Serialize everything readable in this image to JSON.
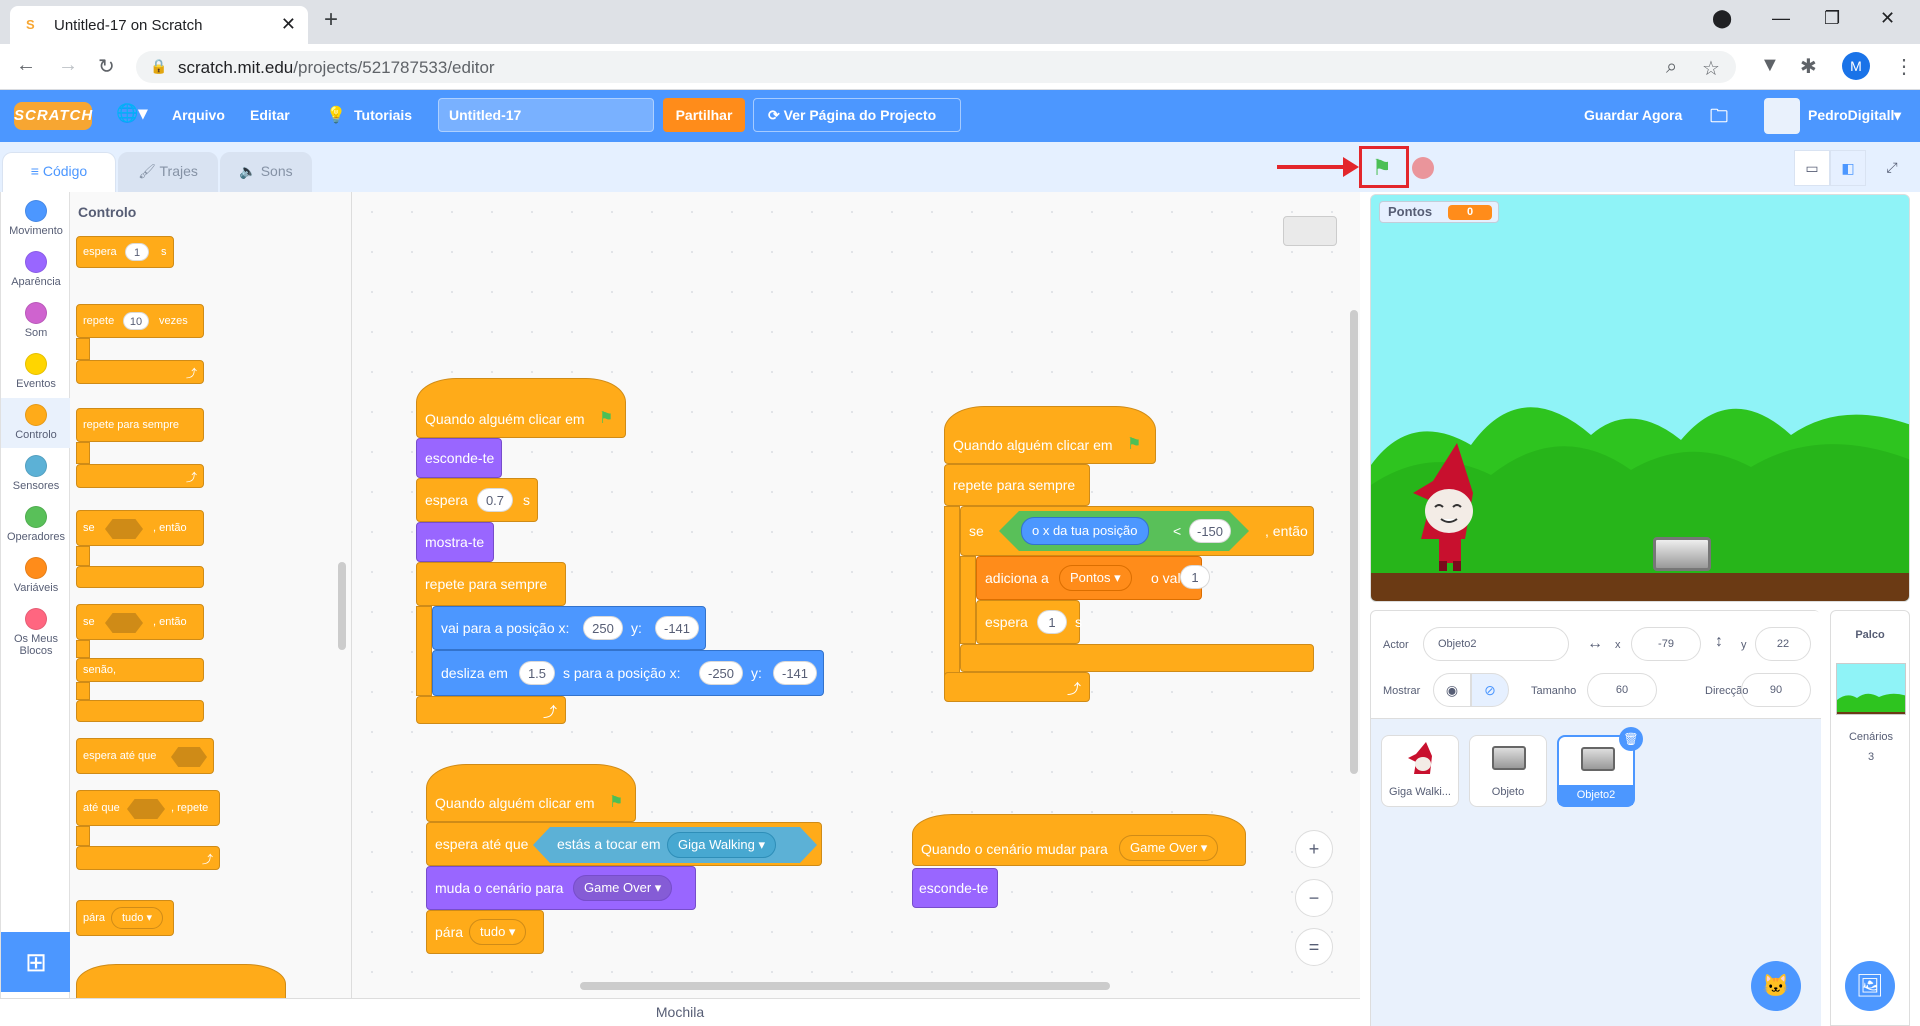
{
  "browser": {
    "tab_title": "Untitled-17 on Scratch",
    "url_host": "scratch.mit.edu",
    "url_path": "/projects/521787533/editor",
    "profile_initial": "M"
  },
  "menu": {
    "logo": "SCRATCH",
    "file": "Arquivo",
    "edit": "Editar",
    "tutorials": "Tutoriais",
    "project_title": "Untitled-17",
    "share": "Partilhar",
    "see_project_page": "Ver Página do Projecto",
    "save_now": "Guardar Agora",
    "username": "PedroDigitall"
  },
  "tabs": {
    "code": "Código",
    "costumes": "Trajes",
    "sounds": "Sons"
  },
  "categories": [
    {
      "label": "Movimento",
      "color": "#4c97ff"
    },
    {
      "label": "Aparência",
      "color": "#9966ff"
    },
    {
      "label": "Som",
      "color": "#cf63cf"
    },
    {
      "label": "Eventos",
      "color": "#ffd500"
    },
    {
      "label": "Controlo",
      "color": "#ffab19"
    },
    {
      "label": "Sensores",
      "color": "#5cb1d6"
    },
    {
      "label": "Operadores",
      "color": "#59c059"
    },
    {
      "label": "Variáveis",
      "color": "#ff8c1a"
    },
    {
      "label": "Os Meus Blocos",
      "color": "#ff6680"
    }
  ],
  "palette": {
    "title": "Controlo",
    "wait": "espera",
    "wait_val": "1",
    "wait_unit": "s",
    "repeat": "repete",
    "repeat_val": "10",
    "repeat_unit": "vezes",
    "forever": "repete para sempre",
    "if": "se",
    "then": ", então",
    "else": "senão,",
    "wait_until": "espera até que",
    "repeat_until": "até que",
    "repeat_until_suffix": ", repete",
    "stop": "pára",
    "stop_opt": "tudo"
  },
  "scripts": {
    "s1": {
      "hat": "Quando alguém clicar em",
      "hide": "esconde-te",
      "wait": "espera",
      "wait_val": "0.7",
      "wait_unit": "s",
      "show": "mostra-te",
      "forever": "repete para sempre",
      "goto": "vai para a posição x:",
      "goto_x": "250",
      "y_lbl": "y:",
      "goto_y": "-141",
      "glide": "desliza em",
      "glide_t": "1.5",
      "glide_mid": "s para a posição x:",
      "glide_x": "-250",
      "glide_y": "-141"
    },
    "s2": {
      "hat": "Quando alguém clicar em",
      "forever": "repete para sempre",
      "if": "se",
      "xpos": "o x da tua posição",
      "lt": "<",
      "lt_val": "-150",
      "then": ", então",
      "change": "adiciona a",
      "var": "Pontos",
      "by": "o valor",
      "by_val": "1",
      "wait": "espera",
      "wait_val": "1",
      "wait_unit": "s"
    },
    "s3": {
      "hat": "Quando alguém clicar em",
      "wait_until": "espera até que",
      "touching": "estás a tocar em",
      "touch_target": "Giga Walking",
      "switch": "muda o cenário para",
      "backdrop": "Game Over",
      "stop": "pára",
      "stop_opt": "tudo"
    },
    "s4": {
      "hat": "Quando o cenário mudar para",
      "backdrop": "Game Over",
      "hide": "esconde-te"
    }
  },
  "zoom": {
    "in": "+",
    "out": "−",
    "reset": "="
  },
  "backpack": "Mochila",
  "stage": {
    "monitor_label": "Pontos",
    "monitor_value": "0"
  },
  "sprite_info": {
    "actor_lbl": "Actor",
    "actor": "Objeto2",
    "x_lbl": "x",
    "x": "-79",
    "y_lbl": "y",
    "y": "22",
    "show_lbl": "Mostrar",
    "size_lbl": "Tamanho",
    "size": "60",
    "dir_lbl": "Direcção",
    "dir": "90"
  },
  "sprites": [
    {
      "name": "Giga Walki..."
    },
    {
      "name": "Objeto"
    },
    {
      "name": "Objeto2"
    }
  ],
  "stage_panel": {
    "title": "Palco",
    "backdrops_lbl": "Cenários",
    "backdrops_count": "3"
  }
}
